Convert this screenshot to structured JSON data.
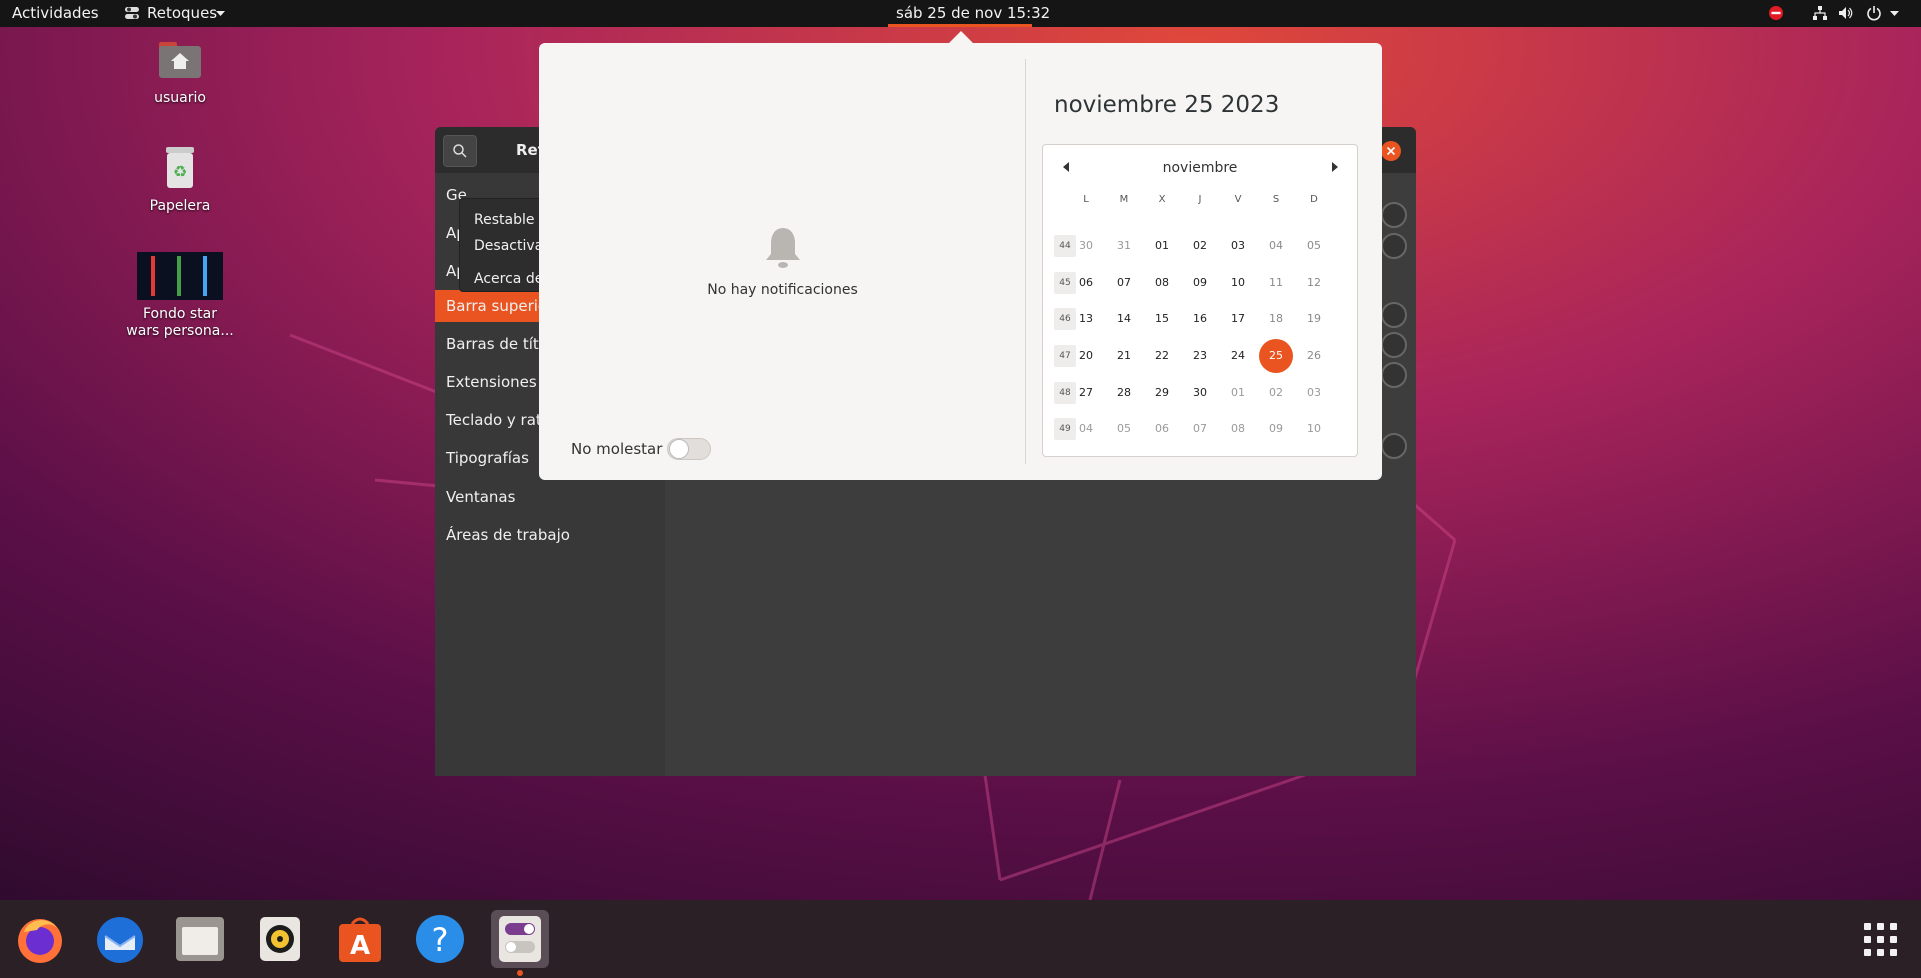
{
  "topbar": {
    "activities": "Actividades",
    "app_menu": "Retoques",
    "clock": "sáb 25 de nov  15:32",
    "tray_icons": [
      "do-not-disturb-icon",
      "network-icon",
      "volume-icon",
      "power-icon",
      "chevron-down-icon"
    ]
  },
  "desktop": {
    "icons": [
      {
        "label": "usuario",
        "icon": "home-folder-icon"
      },
      {
        "label": "Papelera",
        "icon": "trash-icon"
      },
      {
        "label": "Fondo star wars persona...",
        "icon": "image-file-icon"
      }
    ]
  },
  "tweaks": {
    "title": "Ret",
    "sidebar": [
      {
        "label": "Ge",
        "active": false
      },
      {
        "label": "Ap",
        "active": false
      },
      {
        "label": "Ap",
        "active": false
      },
      {
        "label": "Barra superior",
        "active": true
      },
      {
        "label": "Barras de título",
        "active": false
      },
      {
        "label": "Extensiones",
        "active": false
      },
      {
        "label": "Teclado y ratón",
        "active": false
      },
      {
        "label": "Tipografías",
        "active": false
      },
      {
        "label": "Ventanas",
        "active": false
      },
      {
        "label": "Áreas de trabajo",
        "active": false
      }
    ],
    "context_menu": [
      "Restable",
      "Desactiva",
      "Acerca de"
    ]
  },
  "notifications": {
    "empty_text": "No hay notificaciones",
    "dnd_label": "No molestar",
    "dnd_enabled": false
  },
  "calendar": {
    "heading": "noviembre 25 2023",
    "month": "noviembre",
    "weekdays": [
      "L",
      "M",
      "X",
      "J",
      "V",
      "S",
      "D"
    ],
    "weeks": [
      {
        "num": "44",
        "days": [
          [
            "30",
            "other"
          ],
          [
            "31",
            "other"
          ],
          [
            "01",
            ""
          ],
          [
            "02",
            ""
          ],
          [
            "03",
            ""
          ],
          [
            "04",
            "weekend"
          ],
          [
            "05",
            "weekend"
          ]
        ]
      },
      {
        "num": "45",
        "days": [
          [
            "06",
            ""
          ],
          [
            "07",
            ""
          ],
          [
            "08",
            ""
          ],
          [
            "09",
            ""
          ],
          [
            "10",
            ""
          ],
          [
            "11",
            "weekend"
          ],
          [
            "12",
            "weekend"
          ]
        ]
      },
      {
        "num": "46",
        "days": [
          [
            "13",
            ""
          ],
          [
            "14",
            ""
          ],
          [
            "15",
            ""
          ],
          [
            "16",
            ""
          ],
          [
            "17",
            ""
          ],
          [
            "18",
            "weekend"
          ],
          [
            "19",
            "weekend"
          ]
        ]
      },
      {
        "num": "47",
        "days": [
          [
            "20",
            ""
          ],
          [
            "21",
            ""
          ],
          [
            "22",
            ""
          ],
          [
            "23",
            ""
          ],
          [
            "24",
            ""
          ],
          [
            "25",
            "today"
          ],
          [
            "26",
            "weekend"
          ]
        ]
      },
      {
        "num": "48",
        "days": [
          [
            "27",
            ""
          ],
          [
            "28",
            ""
          ],
          [
            "29",
            ""
          ],
          [
            "30",
            ""
          ],
          [
            "01",
            "other"
          ],
          [
            "02",
            "other"
          ],
          [
            "03",
            "other"
          ]
        ]
      },
      {
        "num": "49",
        "days": [
          [
            "04",
            "other"
          ],
          [
            "05",
            "other"
          ],
          [
            "06",
            "other"
          ],
          [
            "07",
            "other"
          ],
          [
            "08",
            "other"
          ],
          [
            "09",
            "other"
          ],
          [
            "10",
            "other"
          ]
        ]
      }
    ]
  },
  "dock": {
    "items": [
      {
        "name": "firefox-icon",
        "running": false
      },
      {
        "name": "thunderbird-icon",
        "running": false
      },
      {
        "name": "files-icon",
        "running": false
      },
      {
        "name": "rhythmbox-icon",
        "running": false
      },
      {
        "name": "software-center-icon",
        "running": false
      },
      {
        "name": "help-icon",
        "running": false
      },
      {
        "name": "tweaks-icon",
        "running": true
      }
    ],
    "show_apps": "show-applications-icon"
  }
}
